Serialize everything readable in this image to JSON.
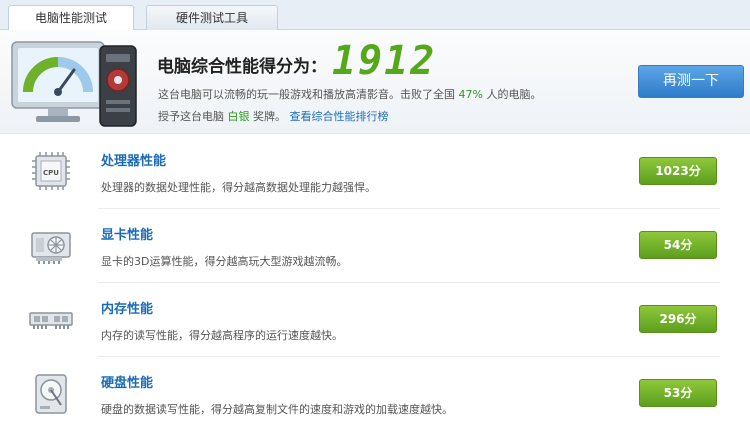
{
  "tabs": [
    {
      "label": "电脑性能测试",
      "active": true
    },
    {
      "label": "硬件测试工具",
      "active": false
    }
  ],
  "header": {
    "score_label": "电脑综合性能得分为：",
    "score_value": "1912",
    "desc_prefix": "这台电脑可以流畅的玩一般游戏和播放高清影音。击败了全国",
    "percent": "47%",
    "desc_suffix": "人的电脑。",
    "award_prefix": "授予这台电脑",
    "award_medal": "白银",
    "award_suffix": "奖牌。",
    "rank_link": "查看综合性能排行榜",
    "retest_label": "再测一下"
  },
  "rows": [
    {
      "title": "处理器性能",
      "desc": "处理器的数据处理性能，得分越高数据处理能力越强悍。",
      "score": "1023分",
      "icon": "cpu-icon"
    },
    {
      "title": "显卡性能",
      "desc": "显卡的3D运算性能，得分越高玩大型游戏越流畅。",
      "score": "54分",
      "icon": "graphics-card-icon"
    },
    {
      "title": "内存性能",
      "desc": "内存的读写性能，得分越高程序的运行速度越快。",
      "score": "296分",
      "icon": "memory-icon"
    },
    {
      "title": "硬盘性能",
      "desc": "硬盘的数据读写性能，得分越高复制文件的速度和游戏的加载速度越快。",
      "score": "53分",
      "icon": "hard-disk-icon"
    }
  ],
  "colors": {
    "title_blue": "#1a6cb7",
    "score_green": "#56a81b",
    "badge_green": "#6fb12a",
    "button_blue": "#3f8ad6"
  }
}
